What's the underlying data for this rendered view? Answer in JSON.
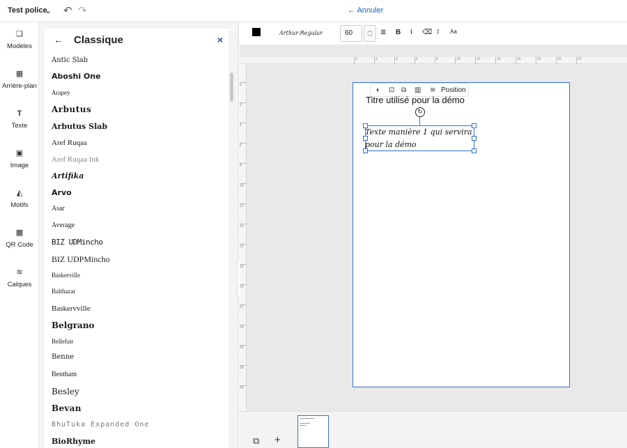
{
  "header": {
    "doc_title": "Test police",
    "chevron_icon": "chevron-down-icon",
    "undo_icon": "undo-icon",
    "redo_icon": "redo-icon",
    "cancel_label": "← Annuler"
  },
  "rail": {
    "items": [
      {
        "label": "Modèles",
        "icon": "templates-icon"
      },
      {
        "label": "Arrière-plan",
        "icon": "background-icon"
      },
      {
        "label": "Texte",
        "icon": "text-icon"
      },
      {
        "label": "Image",
        "icon": "image-icon"
      },
      {
        "label": "Motifs",
        "icon": "shapes-icon"
      },
      {
        "label": "QR Code",
        "icon": "qr-code-icon"
      },
      {
        "label": "Calques",
        "icon": "layers-icon"
      }
    ]
  },
  "panel": {
    "title": "Classique",
    "fonts": [
      "Antic Slab",
      "Aboshi One",
      "Arapey",
      "Arbutus",
      "Arbutus Slab",
      "Aref Ruqaa",
      "Aref Ruqaa Ink",
      "Artifika",
      "Arvo",
      "Asar",
      "Average",
      "BIZ UDMincho",
      "BIZ UDPMincho",
      "Baskerville",
      "Balthazar",
      "Baskervville",
      "Belgrano",
      "Bellefair",
      "Benne",
      "Bentham",
      "Besley",
      "Bevan",
      "BhuTuka Expanded One",
      "BioRhyme"
    ]
  },
  "toolbar": {
    "color": "#000000",
    "font_name": "Arthur-Regular",
    "font_size": "60",
    "bold_label": "B",
    "italic_label": "I",
    "textsize_label": "Aa"
  },
  "canvas": {
    "rulers_h": [
      "0",
      "2",
      "4",
      "6",
      "8",
      "10",
      "12",
      "14",
      "16",
      "18",
      "20",
      "22"
    ],
    "rulers_v": [
      "0",
      "2",
      "4",
      "6",
      "8",
      "10",
      "12",
      "14",
      "16",
      "18",
      "20",
      "22",
      "24",
      "26",
      "28",
      "30"
    ],
    "position_label": "Position",
    "page_title": "Titre utilisé pour la démo",
    "selected_text": "Texte manière 1 qui servira pour la démo"
  },
  "colors": {
    "accent": "#2f6fd6",
    "link": "#1565c0"
  }
}
